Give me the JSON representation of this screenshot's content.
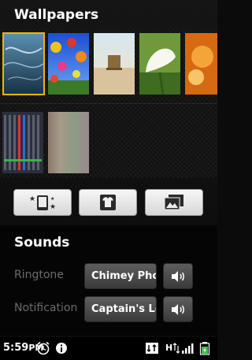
{
  "wallpapers": {
    "title": "Wallpapers",
    "thumbnails": [
      {
        "name": "aurora-blue",
        "selected": true
      },
      {
        "name": "hot-air-balloons",
        "selected": false
      },
      {
        "name": "desert-chair",
        "selected": false
      },
      {
        "name": "calla-lily",
        "selected": false
      },
      {
        "name": "orange-abstract",
        "selected": false
      },
      {
        "name": "pixel-pattern",
        "selected": false
      },
      {
        "name": "blurred-stripes",
        "selected": false
      }
    ],
    "selected_color": "#f4b400"
  },
  "actions": [
    {
      "name": "live-wallpaper",
      "icon": "sparkle-phone-icon"
    },
    {
      "name": "theme",
      "icon": "shirt-icon"
    },
    {
      "name": "gallery",
      "icon": "pictures-icon"
    }
  ],
  "sounds": {
    "title": "Sounds",
    "ringtone": {
      "label": "Ringtone",
      "value": "Chimey Phone"
    },
    "notification": {
      "label": "Notification",
      "value": "Captain's Log"
    }
  },
  "status_bar": {
    "time": "5:59",
    "ampm": "PM",
    "network": "H"
  }
}
